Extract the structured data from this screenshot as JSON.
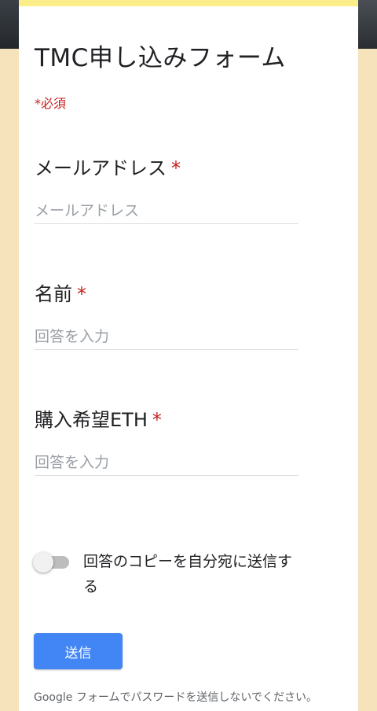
{
  "colors": {
    "accent": "#4285f4",
    "required": "#c5221f",
    "background": "#f6e2bb",
    "card_top_border": "#fbed87"
  },
  "form": {
    "title": "TMC申し込みフォーム",
    "required_note": "*必須"
  },
  "questions": [
    {
      "label": "メールアドレス",
      "required_mark": "*",
      "placeholder": "メールアドレス",
      "value": ""
    },
    {
      "label": "名前",
      "required_mark": "*",
      "placeholder": "回答を入力",
      "value": ""
    },
    {
      "label": "購入希望ETH",
      "required_mark": "*",
      "placeholder": "回答を入力",
      "value": ""
    }
  ],
  "copy_toggle": {
    "label": "回答のコピーを自分宛に送信する",
    "checked": false
  },
  "submit_label": "送信",
  "footer_note": "Google フォームでパスワードを送信しないでください。"
}
